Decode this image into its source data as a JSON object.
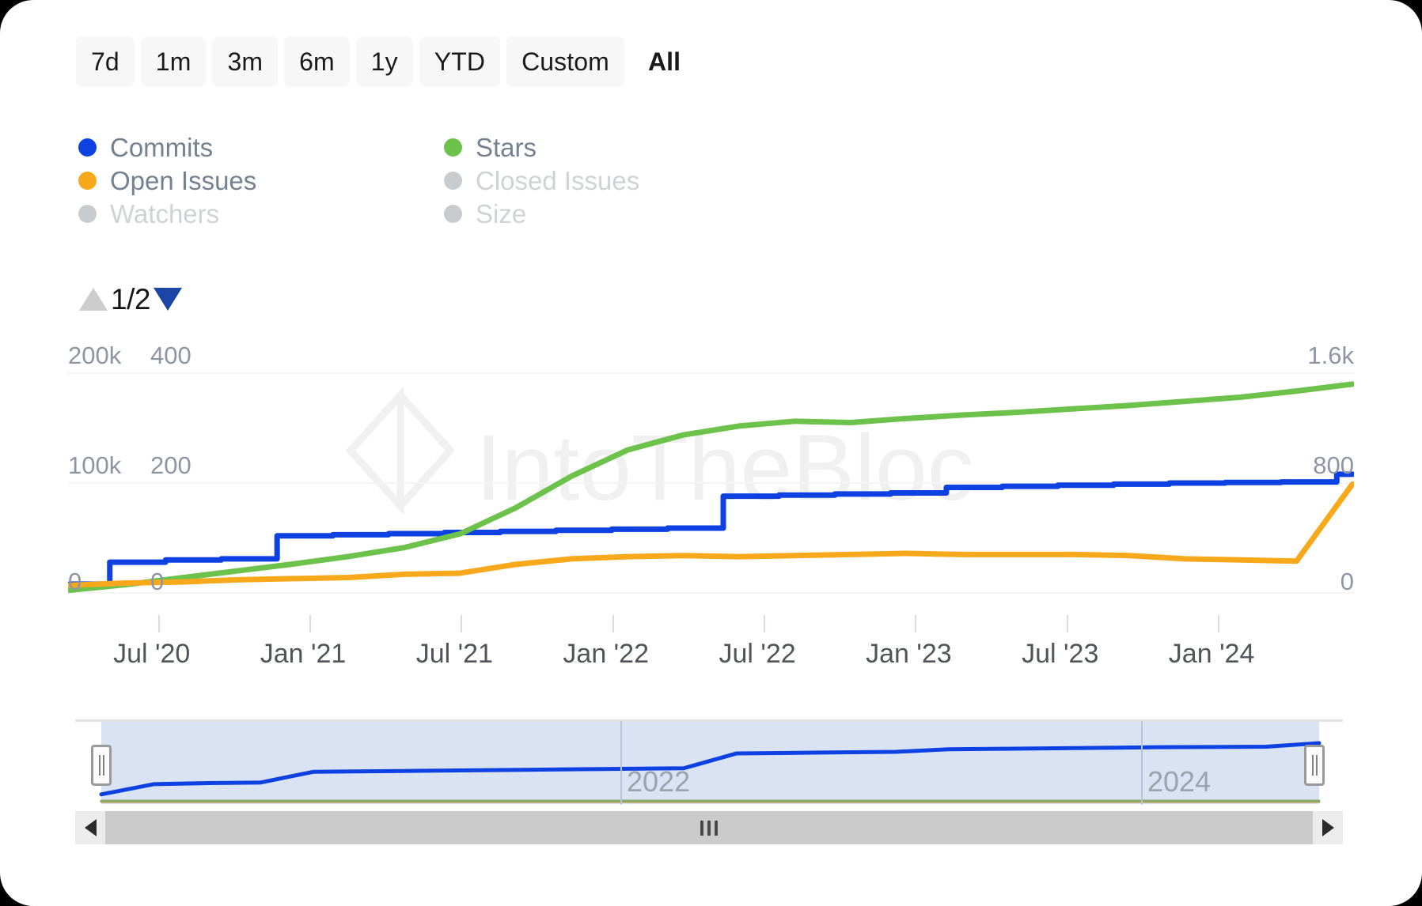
{
  "range_selector": {
    "options": [
      {
        "label": "7d",
        "selected": false
      },
      {
        "label": "1m",
        "selected": false
      },
      {
        "label": "3m",
        "selected": false
      },
      {
        "label": "6m",
        "selected": false
      },
      {
        "label": "1y",
        "selected": false
      },
      {
        "label": "YTD",
        "selected": false
      },
      {
        "label": "Custom",
        "selected": false
      },
      {
        "label": "All",
        "selected": true
      }
    ]
  },
  "legend": {
    "items": [
      {
        "label": "Commits",
        "color": "#0d41e1",
        "enabled": true
      },
      {
        "label": "Stars",
        "color": "#6cc24a",
        "enabled": true
      },
      {
        "label": "Open Issues",
        "color": "#f7a81b",
        "enabled": true
      },
      {
        "label": "Closed Issues",
        "color": "#c9cccf",
        "enabled": false
      },
      {
        "label": "Watchers",
        "color": "#c9cccf",
        "enabled": false
      },
      {
        "label": "Size",
        "color": "#c9cccf",
        "enabled": false
      }
    ]
  },
  "paginator": {
    "page_label": "1/2",
    "up_enabled": false,
    "down_enabled": true
  },
  "watermark": {
    "text": "IntoTheBlock"
  },
  "navigator": {
    "years": [
      "2022",
      "2024"
    ],
    "selection_start_pct": 2,
    "selection_end_pct": 98
  },
  "chart_data": {
    "type": "line",
    "title": "",
    "xlabel": "",
    "grid": true,
    "legend_position": "top-left",
    "x_ticks": [
      "Jul '20",
      "Jan '21",
      "Jul '21",
      "Jan '22",
      "Jul '22",
      "Jan '23",
      "Jul '23",
      "Jan '24"
    ],
    "axes": [
      {
        "id": "commits",
        "side": "left",
        "ticks": [
          "0",
          "100k",
          "200k"
        ],
        "range": [
          0,
          200000
        ],
        "series": "Commits"
      },
      {
        "id": "issues",
        "side": "left",
        "ticks": [
          "0",
          "200",
          "400"
        ],
        "range": [
          0,
          400
        ],
        "series": "Open Issues"
      },
      {
        "id": "stars",
        "side": "right",
        "ticks": [
          "0",
          "800",
          "1.6k"
        ],
        "range": [
          0,
          1600
        ],
        "series": "Stars"
      }
    ],
    "x": [
      "2020-07",
      "2020-09",
      "2020-11",
      "2021-01",
      "2021-03",
      "2021-05",
      "2021-07",
      "2021-09",
      "2021-11",
      "2022-01",
      "2022-03",
      "2022-05",
      "2022-07",
      "2022-09",
      "2022-11",
      "2023-01",
      "2023-03",
      "2023-05",
      "2023-07",
      "2023-09",
      "2023-11",
      "2024-01",
      "2024-03",
      "2024-05"
    ],
    "series": [
      {
        "name": "Commits",
        "color": "#0d41e1",
        "axis": "commits",
        "unit": "",
        "values": [
          8000,
          28000,
          30000,
          31000,
          52000,
          53000,
          54000,
          55000,
          56000,
          57000,
          58000,
          59000,
          88000,
          89000,
          90000,
          91000,
          96000,
          97000,
          98000,
          99000,
          100000,
          100500,
          101000,
          108000
        ]
      },
      {
        "name": "Stars",
        "color": "#6cc24a",
        "axis": "stars",
        "unit": "",
        "values": [
          20,
          60,
          110,
          160,
          210,
          265,
          330,
          430,
          620,
          850,
          1040,
          1150,
          1215,
          1250,
          1240,
          1270,
          1295,
          1315,
          1340,
          1365,
          1395,
          1425,
          1470,
          1520
        ]
      },
      {
        "name": "Open Issues",
        "color": "#f7a81b",
        "axis": "issues",
        "unit": "",
        "values": [
          14,
          18,
          20,
          24,
          26,
          28,
          34,
          36,
          52,
          62,
          66,
          68,
          66,
          68,
          70,
          72,
          70,
          70,
          70,
          68,
          62,
          60,
          58,
          198
        ]
      }
    ]
  }
}
